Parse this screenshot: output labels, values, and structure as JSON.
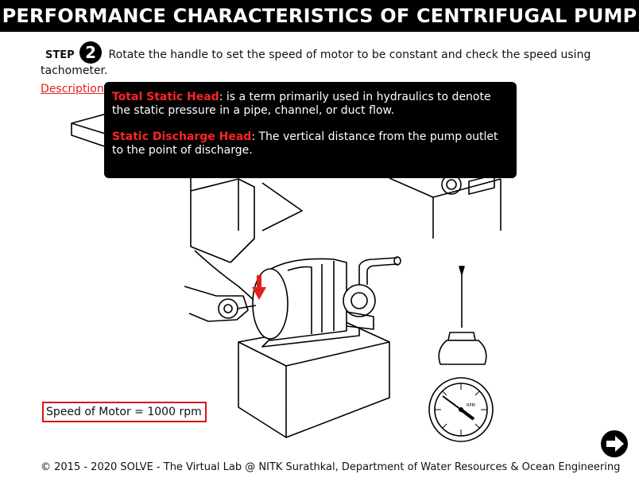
{
  "title": "PERFORMANCE CHARACTERISTICS OF CENTRIFUGAL PUMP",
  "step": {
    "label": "STEP",
    "number": "2",
    "instruction": "Rotate the handle to set the speed of motor to be constant and check the speed using tachometer."
  },
  "description_link": "Description",
  "tooltip": {
    "items": [
      {
        "term": "Total Static Head",
        "text": ": is a term primarily used in hydraulics to denote the static pressure in a pipe, channel, or duct flow."
      },
      {
        "term": "Static Discharge Head",
        "text": ": The vertical distance from the pump outlet to the point of discharge."
      }
    ]
  },
  "tachometer": {
    "scale_label": "RPM"
  },
  "speed_readout": "Speed of Motor = 1000 rpm",
  "footer": "© 2015 - 2020 SOLVE - The Virtual Lab @ NITK Surathkal, Department of Water Resources & Ocean Engineering",
  "colors": {
    "title_bg": "#000000",
    "accent_red": "#e0211d",
    "tooltip_bg": "#000000"
  },
  "icons": {
    "next": "arrow-right-icon",
    "pointer": "red-down-arrow-icon"
  }
}
